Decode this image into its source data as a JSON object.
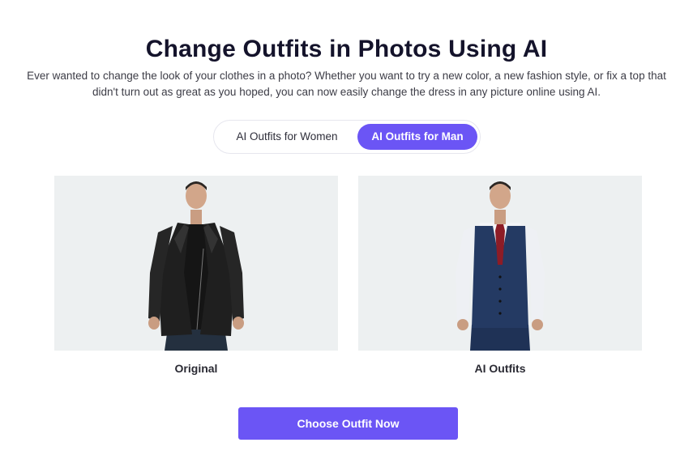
{
  "header": {
    "title": "Change Outfits in Photos Using AI",
    "description": "Ever wanted to change the look of your clothes in a photo? Whether you want to try a new color, a new fashion style, or fix a top that didn't turn out as great as you hoped, you can now easily change the dress in any picture online using AI."
  },
  "tabs": [
    {
      "label": "AI Outfits for Women",
      "active": false
    },
    {
      "label": "AI Outfits for Man",
      "active": true
    }
  ],
  "comparison": {
    "original_caption": "Original",
    "result_caption": "AI Outfits"
  },
  "cta": {
    "label": "Choose Outfit Now"
  },
  "colors": {
    "accent": "#6b55f5",
    "panel_bg": "#edf0f1",
    "title": "#14132b"
  }
}
